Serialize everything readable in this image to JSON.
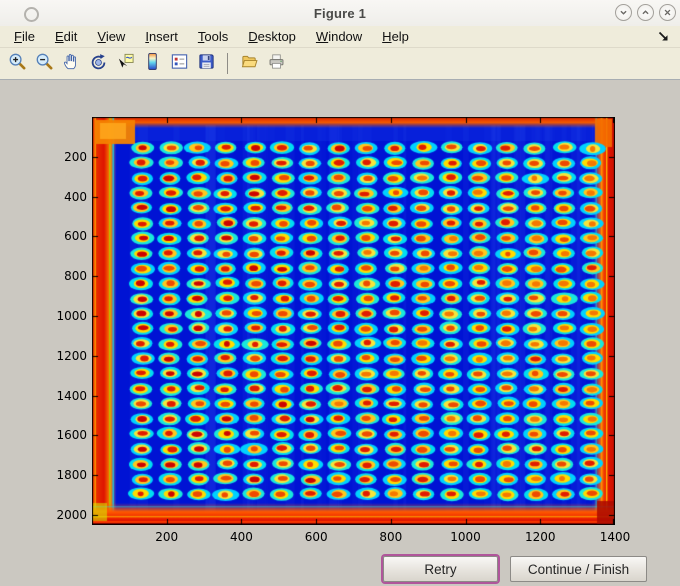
{
  "window": {
    "title": "Figure 1",
    "controls": [
      {
        "name": "minimize-button",
        "icon": "chevron-down-icon"
      },
      {
        "name": "maximize-button",
        "icon": "chevron-up-icon"
      },
      {
        "name": "close-button",
        "icon": "close-icon"
      }
    ]
  },
  "menu": {
    "items": [
      {
        "label": "File"
      },
      {
        "label": "Edit"
      },
      {
        "label": "View"
      },
      {
        "label": "Insert"
      },
      {
        "label": "Tools"
      },
      {
        "label": "Desktop"
      },
      {
        "label": "Window"
      },
      {
        "label": "Help"
      }
    ],
    "dock_arrow_icon": "dock-figure-icon"
  },
  "toolbar": {
    "tools": [
      "zoom-in",
      "zoom-out",
      "pan",
      "rotate-3d",
      "data-cursor",
      "insert-colorbar",
      "insert-legend",
      "save-figure",
      "|",
      "open-file",
      "print-figure"
    ]
  },
  "figure_plot": {
    "type": "image",
    "content": "microarray scan shown with jet colormap: deep blue field, regular grid of spots (cyan halo, yellow ring, red/orange core), saturated red-orange bands on all four image edges",
    "x_ticks": [
      200,
      400,
      600,
      800,
      1000,
      1200,
      1400
    ],
    "y_ticks": [
      200,
      400,
      600,
      800,
      1000,
      1200,
      1400,
      1600,
      1800,
      2000
    ],
    "x_range": [
      0,
      1400
    ],
    "y_range": [
      0,
      2050
    ],
    "spot_grid": {
      "cols": 17,
      "rows": 24
    },
    "colors": {
      "field": "#0013D4",
      "spot_outer": "#00E2F2",
      "spot_ring": "#FFD500",
      "spot_core": "#DC1400",
      "edge_red": "#E62800",
      "edge_orange": "#FF7A00"
    }
  },
  "action_buttons": {
    "retry": "Retry",
    "continue_finish": "Continue / Finish"
  },
  "colors": {
    "chrome_beige": "#EFECDB",
    "client_gray": "#CBC8C1",
    "focus_ring": "#B0569B"
  }
}
